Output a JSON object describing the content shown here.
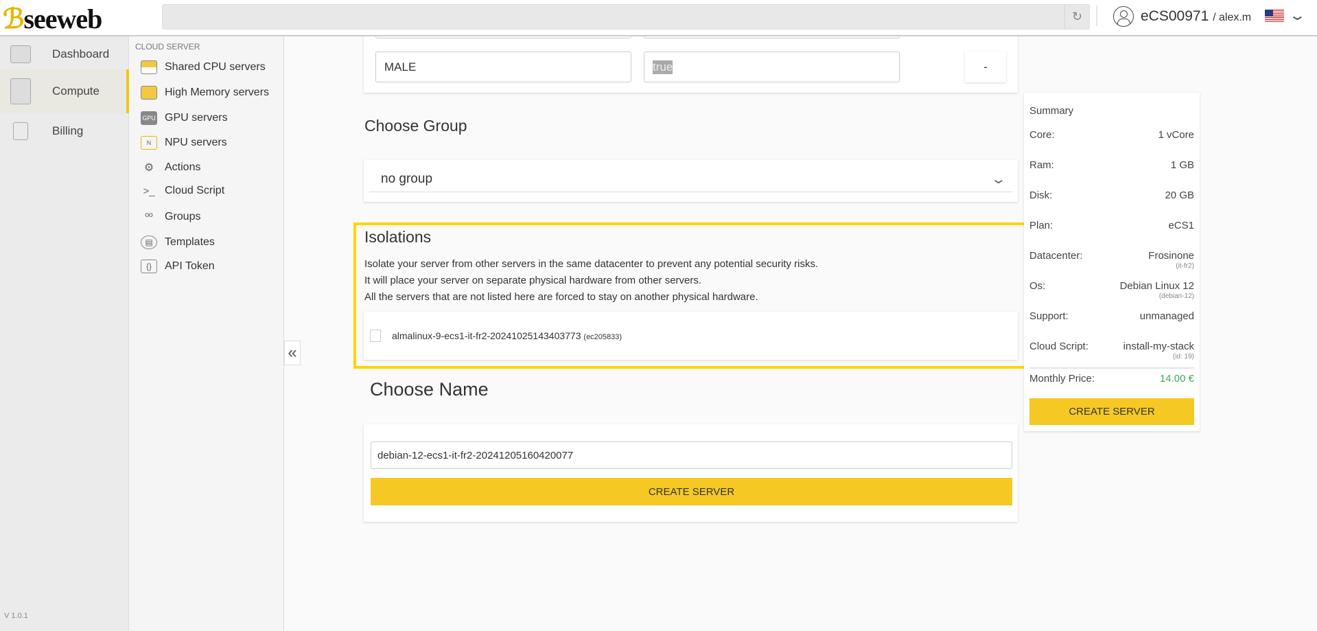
{
  "header": {
    "logo": "seeweb",
    "account_id": "eCS00971",
    "username": "/ alex.m",
    "icons": [
      "refresh-icon",
      "user-icon",
      "us-flag-icon",
      "chevron-down-icon"
    ]
  },
  "sidebar": {
    "items": [
      {
        "label": "Dashboard",
        "icon": "dashboard-icon"
      },
      {
        "label": "Compute",
        "icon": "compute-icon",
        "active": true
      },
      {
        "label": "Billing",
        "icon": "billing-icon"
      }
    ],
    "version": "V 1.0.1"
  },
  "subnav": {
    "section": "CLOUD SERVER",
    "items": [
      {
        "label": "Shared CPU servers",
        "icon": ""
      },
      {
        "label": "High Memory servers",
        "icon": ""
      },
      {
        "label": "GPU servers",
        "icon": "GPU"
      },
      {
        "label": "NPU servers",
        "icon": "N"
      },
      {
        "label": "Actions",
        "icon": "⚙"
      },
      {
        "label": "Cloud Script",
        "icon": ">_"
      },
      {
        "label": "Groups",
        "icon": "ºº"
      },
      {
        "label": "Templates",
        "icon": "▤"
      },
      {
        "label": "API Token",
        "icon": "{}"
      }
    ]
  },
  "metadata": {
    "key": "MALE",
    "value": "true",
    "remove_label": "-"
  },
  "group": {
    "title": "Choose Group",
    "selected": "no group"
  },
  "isolations": {
    "title": "Isolations",
    "lines": [
      "Isolate your server from other servers in the same datacenter to prevent any potential security risks.",
      "It will place your server on separate physical hardware from other servers.",
      "All the servers that are not listed here are forced to stay on another physical hardware."
    ],
    "servers": [
      {
        "name": "almalinux-9-ecs1-it-fr2-20241025143403773",
        "id": "(ec205833)",
        "checked": false
      }
    ]
  },
  "name": {
    "title": "Choose Name",
    "value": "debian-12-ecs1-it-fr2-20241205160420077",
    "create_label": "CREATE SERVER"
  },
  "summary": {
    "title": "Summary",
    "rows": [
      {
        "label": "Core:",
        "value": "1 vCore"
      },
      {
        "label": "Ram:",
        "value": "1 GB"
      },
      {
        "label": "Disk:",
        "value": "20 GB"
      },
      {
        "label": "Plan:",
        "value": "eCS1"
      },
      {
        "label": "Datacenter:",
        "value": "Frosinone",
        "sub": "(it-fr2)"
      },
      {
        "label": "Os:",
        "value": "Debian Linux 12",
        "sub": "(debian-12)"
      },
      {
        "label": "Support:",
        "value": "unmanaged"
      },
      {
        "label": "Cloud Script:",
        "value": "install-my-stack",
        "sub": "(id: 19)"
      }
    ],
    "price_label": "Monthly Price:",
    "price": "14.00 €",
    "price_color": "#3aaa5c",
    "create_label": "CREATE SERVER"
  },
  "colors": {
    "accent": "#f5c823",
    "highlight": "#ffd400"
  }
}
